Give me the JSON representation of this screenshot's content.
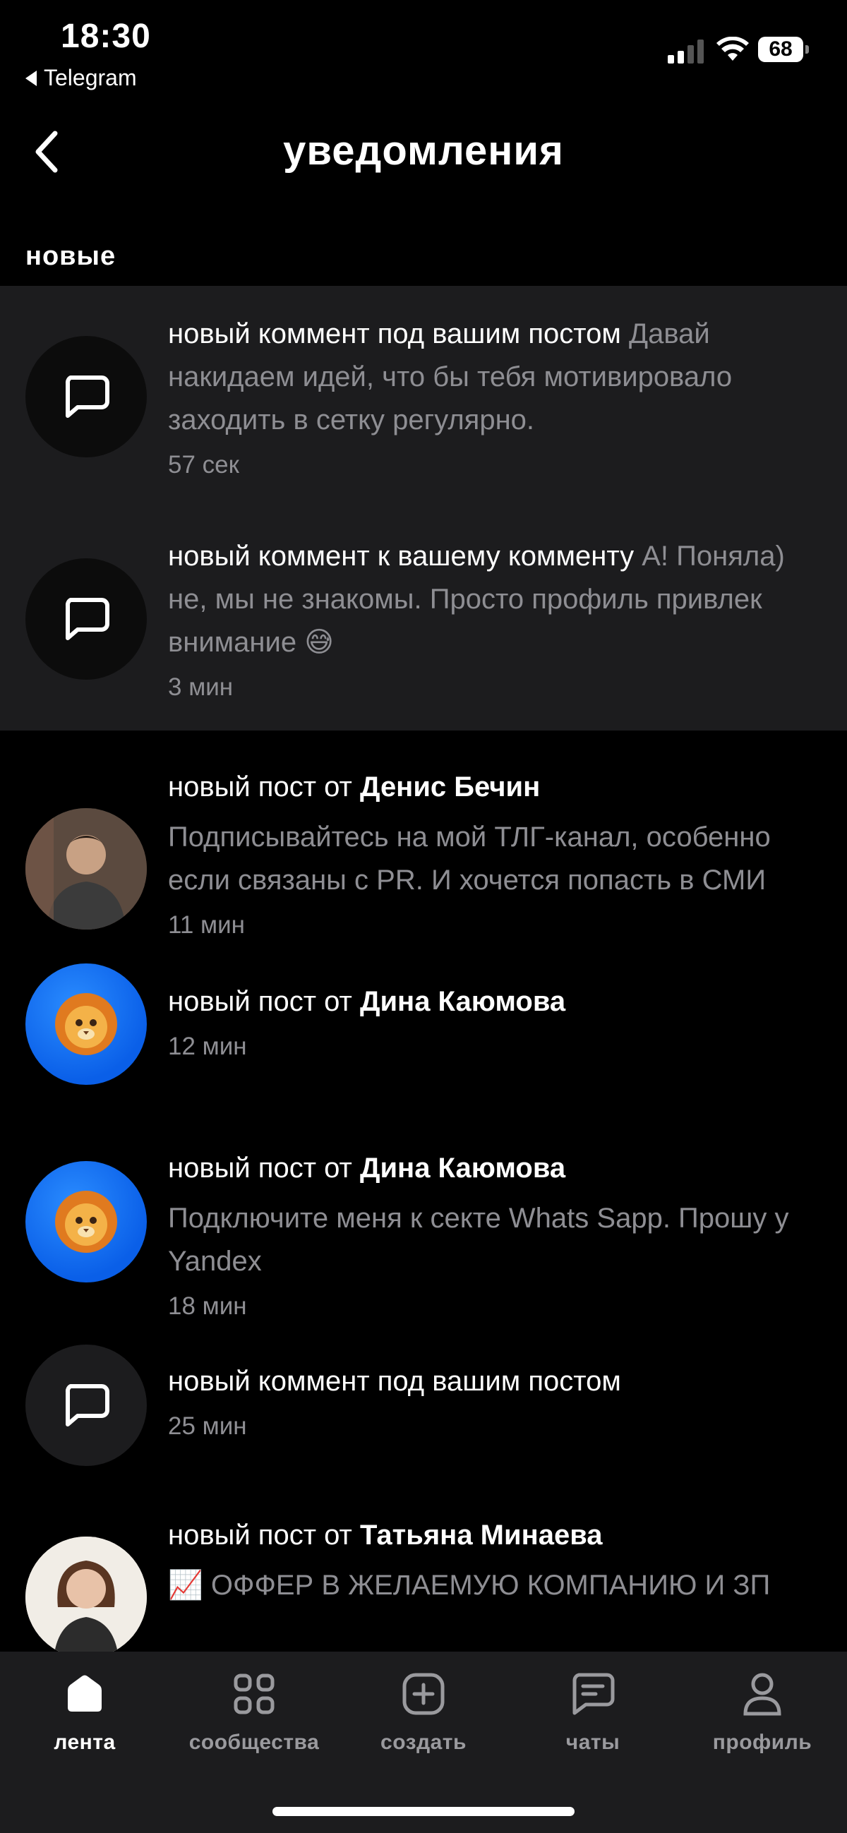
{
  "status_bar": {
    "time": "18:30",
    "back_app": "Telegram",
    "battery": "68"
  },
  "header": {
    "title": "уведомления",
    "back_icon": "chevron-left-icon"
  },
  "section_label": "новые",
  "notifications": [
    {
      "type": "comment",
      "unread": true,
      "icon": "comment-bubble-icon",
      "title": "новый коммент под вашим постом",
      "preview": "Давай накидаем идей, что бы тебя мотивировало заходить в сетку регулярно.",
      "time": "57 сек"
    },
    {
      "type": "comment",
      "unread": true,
      "icon": "comment-bubble-icon",
      "title": "новый коммент к вашему комменту",
      "preview": "А! Поняла) не, мы не знакомы. Просто профиль привлек внимание 😅",
      "time": "3 мин"
    },
    {
      "type": "post",
      "unread": false,
      "avatar": "user-photo",
      "prefix": "новый пост от",
      "author": "Денис Бечин",
      "body": "Подписывайтесь на мой ТЛГ-канал, особенно если связаны с PR. И хочется попасть в СМИ",
      "time": "11 мин"
    },
    {
      "type": "post",
      "unread": false,
      "avatar": "lion-emoji",
      "prefix": "новый пост от",
      "author": "Дина Каюмова",
      "body": "",
      "time": "12 мин"
    },
    {
      "type": "post",
      "unread": false,
      "avatar": "lion-emoji",
      "prefix": "новый пост от",
      "author": "Дина Каюмова",
      "body": "Подключите меня к секте Whats Sapp. Прошу у Yandex",
      "time": "18 мин"
    },
    {
      "type": "comment",
      "unread": false,
      "icon": "comment-bubble-icon",
      "title": "новый коммент под вашим постом",
      "preview": "",
      "time": "25 мин"
    },
    {
      "type": "post",
      "unread": false,
      "avatar": "user-photo",
      "prefix": "новый пост от",
      "author": "Татьяна Минаева",
      "body": "📈 ОФФЕР В ЖЕЛАЕМУЮ КОМПАНИЮ И ЗП",
      "time": ""
    }
  ],
  "tab_bar": {
    "tabs": [
      {
        "label": "лента",
        "icon": "home-icon",
        "active": true
      },
      {
        "label": "сообщества",
        "icon": "grid-icon",
        "active": false
      },
      {
        "label": "создать",
        "icon": "plus-square-icon",
        "active": false
      },
      {
        "label": "чаты",
        "icon": "chat-icon",
        "active": false
      },
      {
        "label": "профиль",
        "icon": "person-icon",
        "active": false
      }
    ]
  },
  "colors": {
    "background": "#000000",
    "unread_background": "#1c1c1e",
    "secondary_text": "#8e8e93",
    "lion_avatar": "#0a5fe8"
  }
}
